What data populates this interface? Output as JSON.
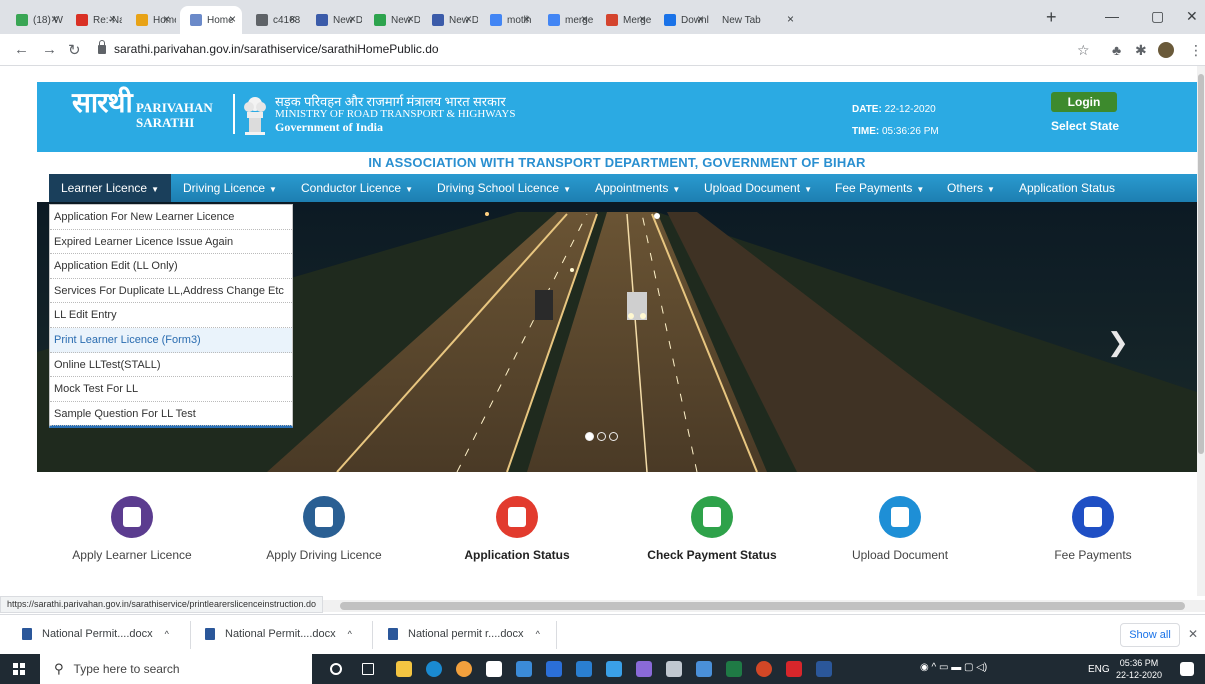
{
  "browser": {
    "tabs": [
      {
        "label": "(18) W",
        "color": "#3aa655"
      },
      {
        "label": "Re:-Na",
        "color": "#d93025"
      },
      {
        "label": "Home",
        "color": "#e8a317"
      },
      {
        "label": "Home",
        "color": "#6b8ac9",
        "active": true
      },
      {
        "label": "c4168",
        "color": "#5f6368"
      },
      {
        "label": "New D",
        "color": "#3b5ba9"
      },
      {
        "label": "New D",
        "color": "#2da44e"
      },
      {
        "label": "New D",
        "color": "#3b5ba9"
      },
      {
        "label": "motih",
        "color": "#4285f4"
      },
      {
        "label": "merge",
        "color": "#4285f4"
      },
      {
        "label": "Merge",
        "color": "#d4442e"
      },
      {
        "label": "Downl",
        "color": "#1a73e8"
      },
      {
        "label": "New Tab",
        "color": ""
      }
    ],
    "tab_close": "×",
    "new_tab": "+",
    "url": "sarathi.parivahan.gov.in/sarathiservice/sarathiHomePublic.do",
    "status_url": "https://sarathi.parivahan.gov.in/sarathiservice/printlearerslicenceinstruction.do"
  },
  "header": {
    "logo_sarathi": "सारथी",
    "logo_line1": "PARIVAHAN",
    "logo_line2": "SARATHI",
    "ministry_hindi": "सड़क परिवहन और राजमार्ग मंत्रालय भारत सरकार",
    "ministry_english": "MINISTRY OF ROAD TRANSPORT & HIGHWAYS",
    "government": "Government of India",
    "date_label": "DATE:",
    "date_value": "22-12-2020",
    "time_label": "TIME:",
    "time_value": "05:36:26 PM",
    "login": "Login",
    "select_state": "Select State",
    "association": "IN ASSOCIATION WITH TRANSPORT DEPARTMENT, GOVERNMENT OF BIHAR"
  },
  "menu": {
    "items": [
      {
        "label": "Learner Licence",
        "caret": true
      },
      {
        "label": "Driving Licence",
        "caret": true
      },
      {
        "label": "Conductor Licence",
        "caret": true
      },
      {
        "label": "Driving School Licence",
        "caret": true
      },
      {
        "label": "Appointments",
        "caret": true
      },
      {
        "label": "Upload Document",
        "caret": true
      },
      {
        "label": "Fee Payments",
        "caret": true
      },
      {
        "label": "Others",
        "caret": true
      },
      {
        "label": "Application Status",
        "caret": false
      }
    ],
    "dropdown": [
      "Application For New Learner Licence",
      "Expired Learner Licence Issue Again",
      "Application Edit (LL Only)",
      "Services For Duplicate LL,Address Change Etc",
      "LL Edit Entry",
      "Print Learner Licence (Form3)",
      "Online LLTest(STALL)",
      "Mock Test For LL",
      "Sample Question For LL Test"
    ]
  },
  "services": [
    {
      "label": "Apply Learner Licence",
      "color": "#5b3c8f",
      "bold": false
    },
    {
      "label": "Apply Driving Licence",
      "color": "#2a5f93",
      "bold": false
    },
    {
      "label": "Application Status",
      "color": "#e23b2e",
      "bold": true
    },
    {
      "label": "Check Payment Status",
      "color": "#2ea24a",
      "bold": true
    },
    {
      "label": "Upload Document",
      "color": "#1e8fd6",
      "bold": false
    },
    {
      "label": "Fee Payments",
      "color": "#1f4fc4",
      "bold": false
    }
  ],
  "downloads": {
    "items": [
      "National Permit....docx",
      "National Permit....docx",
      "National permit r....docx"
    ],
    "show_all": "Show all"
  },
  "taskbar": {
    "search_placeholder": "Type here to search",
    "language": "ENG",
    "time": "05:36 PM",
    "date": "22-12-2020"
  }
}
